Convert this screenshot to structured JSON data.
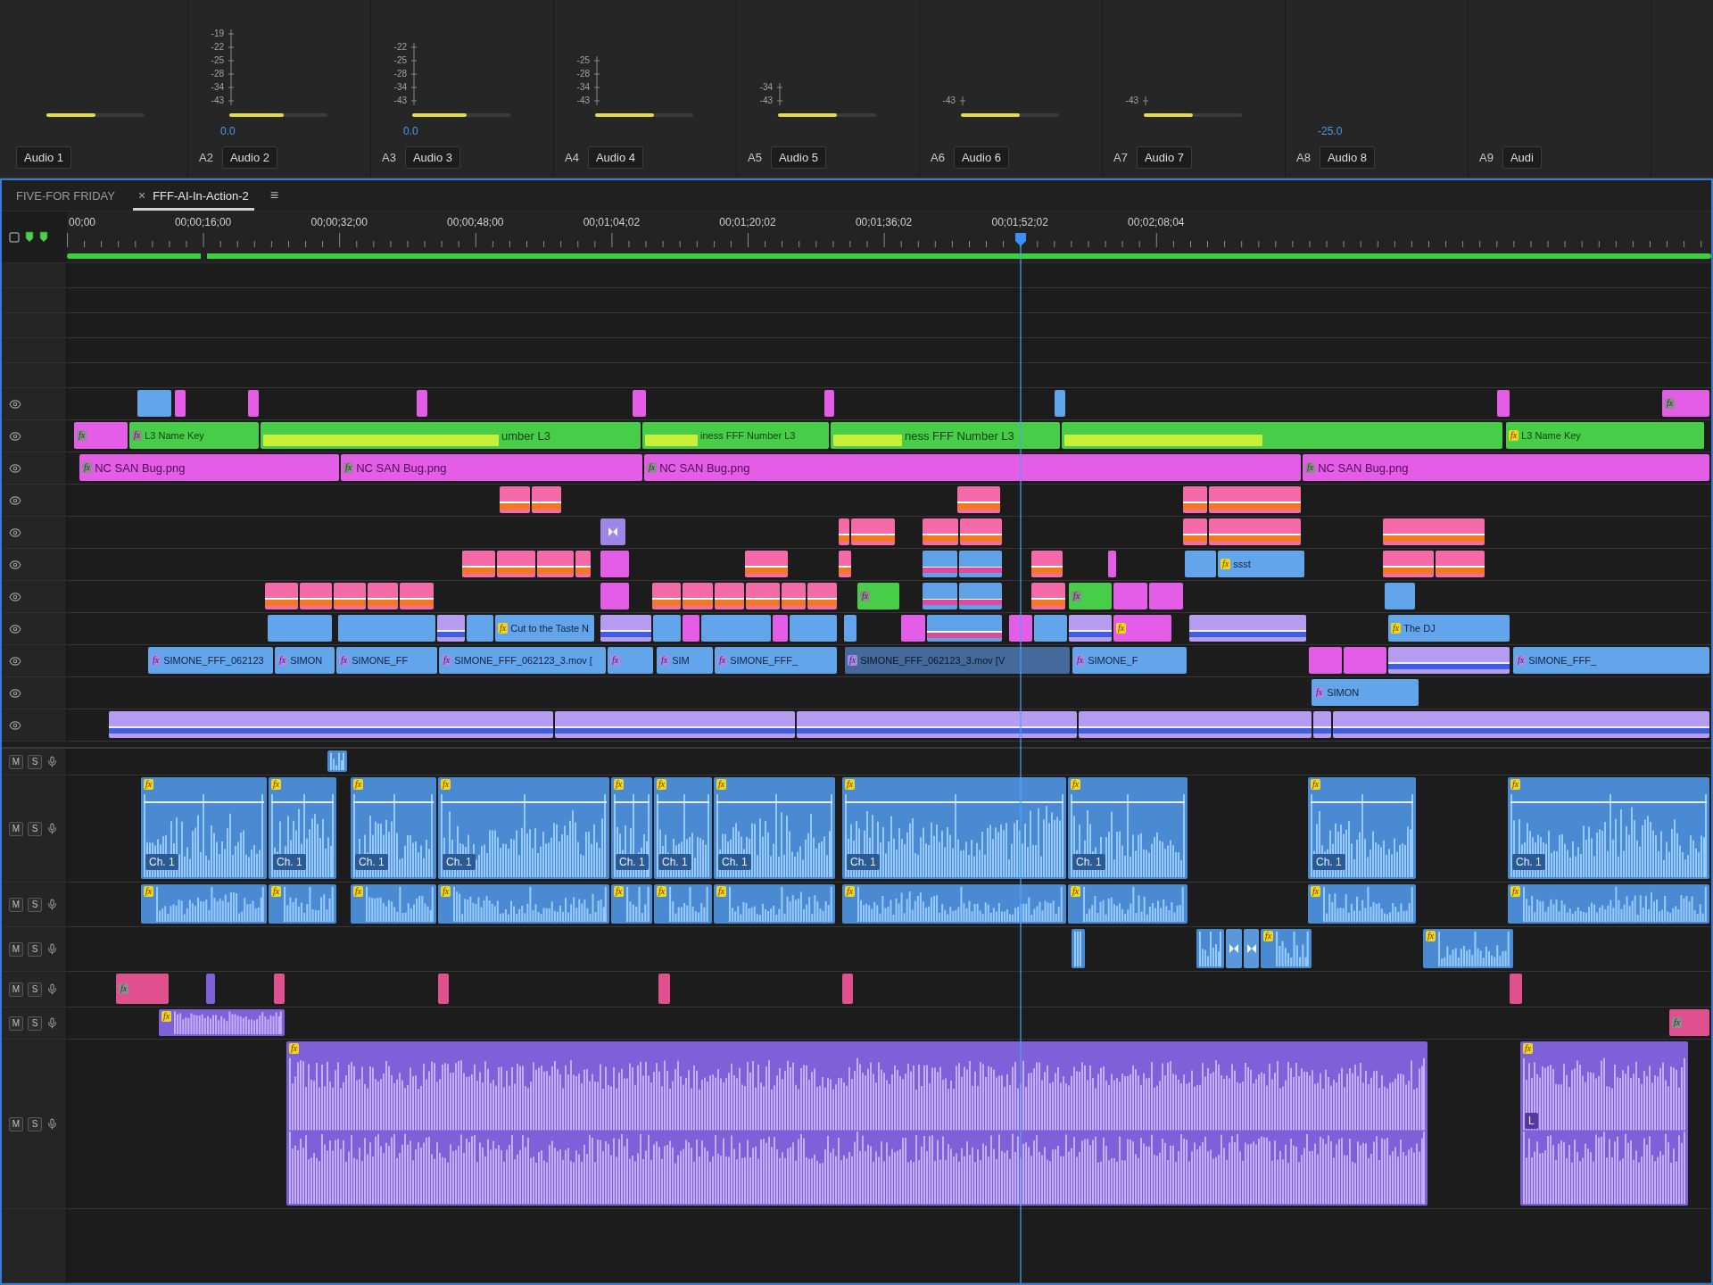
{
  "mixer": {
    "channels": [
      {
        "name": "Audio 1",
        "level": 0.5
      },
      {
        "track": "A2",
        "name": "Audio 2",
        "scale": [
          "-19",
          "-22",
          "-25",
          "-28",
          "-34",
          "-43"
        ],
        "reading": "0.0",
        "level": 0.55
      },
      {
        "track": "A3",
        "name": "Audio 3",
        "scale": [
          "-22",
          "-25",
          "-28",
          "-34",
          "-43"
        ],
        "reading": "0.0",
        "level": 0.55
      },
      {
        "track": "A4",
        "name": "Audio 4",
        "scale": [
          "-25",
          "-28",
          "-34",
          "-43"
        ],
        "level": 0.6
      },
      {
        "track": "A5",
        "name": "Audio 5",
        "scale": [
          "-34",
          "-43"
        ],
        "level": 0.6
      },
      {
        "track": "A6",
        "name": "Audio 6",
        "scale": [
          "-43"
        ],
        "level": 0.6
      },
      {
        "track": "A7",
        "name": "Audio 7",
        "scale": [
          "-43"
        ],
        "level": 0.5
      },
      {
        "track": "A8",
        "name": "Audio 8",
        "reading": "-25.0"
      },
      {
        "track": "A9",
        "name": "Audi"
      }
    ]
  },
  "timeline": {
    "tabs": [
      {
        "label": "FIVE-FOR FRIDAY",
        "selected": false
      },
      {
        "label": "FFF-AI-In-Action-2",
        "selected": true,
        "close": "×",
        "menu": "≡"
      }
    ],
    "ruler": {
      "timecodes": [
        "00;00",
        "00;00;16;00",
        "00;00;32;00",
        "00;00;48;00",
        "00;01;04;02",
        "00;01;20;02",
        "00;01;36;02",
        "00;01;52;02",
        "00;02;08;04"
      ]
    },
    "playhead": {
      "level": 0.58
    },
    "video_tracks": [
      {
        "clips": [
          {
            "kind": "video"
          },
          {
            "kind": "graphic"
          },
          {
            "kind": "graphic"
          },
          {
            "kind": "graphic"
          },
          {
            "kind": "graphic"
          },
          {
            "kind": "graphic"
          },
          {
            "kind": "video"
          },
          {
            "kind": "graphic"
          },
          {
            "kind": "graphic",
            "badge": {
              "text": "fx",
              "kind": "plain"
            }
          }
        ]
      },
      {
        "clips": [
          {
            "kind": "graphic",
            "badge": {
              "text": "fx",
              "kind": "plain"
            }
          },
          {
            "kind": "title",
            "label": "L3 Name Key",
            "badge": {
              "text": "fx",
              "kind": "plain"
            }
          },
          {
            "kind": "title",
            "label": "umber L3",
            "overlay_bar": true
          },
          {
            "kind": "title",
            "label": "iness FFF Number L3",
            "overlay_bar": true
          },
          {
            "kind": "title",
            "label": "ness FFF Number L3",
            "overlay_bar": true
          },
          {
            "kind": "title",
            "overlay_bar": true
          },
          {
            "kind": "title",
            "label": "L3 Name Key",
            "badge": {
              "text": "fx",
              "kind": "applied"
            }
          }
        ]
      },
      {
        "clips": [
          {
            "kind": "graphic",
            "label": "NC SAN Bug.png",
            "badge": {
              "text": "fx",
              "kind": "plain"
            }
          },
          {
            "kind": "graphic",
            "label": "NC SAN Bug.png",
            "badge": {
              "text": "fx",
              "kind": "plain"
            }
          },
          {
            "kind": "graphic",
            "label": "NC SAN Bug.png",
            "badge": {
              "text": "fx",
              "kind": "plain"
            }
          },
          {
            "kind": "graphic",
            "label": "NC SAN Bug.png",
            "badge": {
              "text": "fx",
              "kind": "plain"
            }
          }
        ]
      },
      {
        "clips": [
          {
            "kind": "nest"
          },
          {
            "kind": "nest"
          },
          {
            "kind": "nest"
          },
          {
            "kind": "nest"
          },
          {
            "kind": "nest"
          }
        ]
      },
      {
        "clips": [
          {
            "kind": "transition"
          },
          {
            "kind": "nest"
          },
          {
            "kind": "nest"
          },
          {
            "kind": "nest"
          },
          {
            "kind": "nest"
          },
          {
            "kind": "nest"
          },
          {
            "kind": "nest"
          },
          {
            "kind": "nest"
          }
        ]
      },
      {
        "clips": [
          {
            "kind": "nest"
          },
          {
            "kind": "nest"
          },
          {
            "kind": "nest"
          },
          {
            "kind": "nest"
          },
          {
            "kind": "graphic"
          },
          {
            "kind": "nest"
          },
          {
            "kind": "nest"
          },
          {
            "kind": "composite"
          },
          {
            "kind": "composite"
          },
          {
            "kind": "nest"
          },
          {
            "kind": "graphic"
          },
          {
            "kind": "video"
          },
          {
            "kind": "video",
            "label": "ssst",
            "badge": {
              "text": "fx",
              "kind": "applied"
            }
          },
          {
            "kind": "nest"
          },
          {
            "kind": "nest"
          }
        ]
      },
      {
        "clips": [
          {
            "kind": "nest"
          },
          {
            "kind": "nest"
          },
          {
            "kind": "nest"
          },
          {
            "kind": "nest"
          },
          {
            "kind": "nest"
          },
          {
            "kind": "graphic"
          },
          {
            "kind": "nest"
          },
          {
            "kind": "nest"
          },
          {
            "kind": "nest"
          },
          {
            "kind": "nest"
          },
          {
            "kind": "nest"
          },
          {
            "kind": "nest"
          },
          {
            "kind": "title",
            "badge": {
              "text": "fx",
              "kind": "plain"
            }
          },
          {
            "kind": "composite"
          },
          {
            "kind": "composite"
          },
          {
            "kind": "nest"
          },
          {
            "kind": "title",
            "badge": {
              "text": "fx",
              "kind": "plain"
            }
          },
          {
            "kind": "graphic"
          },
          {
            "kind": "graphic"
          },
          {
            "kind": "video"
          }
        ]
      },
      {
        "clips": [
          {
            "kind": "video"
          },
          {
            "kind": "video"
          },
          {
            "kind": "adjustment"
          },
          {
            "kind": "video"
          },
          {
            "kind": "video",
            "label": "Cut to the Taste N",
            "badge": {
              "text": "fx",
              "kind": "applied"
            }
          },
          {
            "kind": "adjustment"
          },
          {
            "kind": "video"
          },
          {
            "kind": "graphic"
          },
          {
            "kind": "video"
          },
          {
            "kind": "graphic"
          },
          {
            "kind": "video"
          },
          {
            "kind": "video"
          },
          {
            "kind": "graphic"
          },
          {
            "kind": "composite"
          },
          {
            "kind": "graphic"
          },
          {
            "kind": "video"
          },
          {
            "kind": "adjustment"
          },
          {
            "kind": "graphic",
            "badge": {
              "text": "fx",
              "kind": "applied"
            }
          },
          {
            "kind": "adjustment"
          },
          {
            "kind": "video",
            "label": "The DJ",
            "badge": {
              "text": "fx",
              "kind": "applied"
            }
          }
        ]
      },
      {
        "clips": [
          {
            "kind": "video",
            "label": "SIMONE_FFF_062123",
            "badge": {
              "text": "fx",
              "kind": "intrinsic"
            }
          },
          {
            "kind": "video",
            "label": "SIMON",
            "badge": {
              "text": "fx",
              "kind": "intrinsic"
            }
          },
          {
            "kind": "video",
            "label": "SIMONE_FF",
            "badge": {
              "text": "fx",
              "kind": "intrinsic"
            }
          },
          {
            "kind": "video",
            "label": "SIMONE_FFF_062123_3.mov [",
            "badge": {
              "text": "fx",
              "kind": "intrinsic"
            }
          },
          {
            "kind": "video",
            "badge": {
              "text": "fx",
              "kind": "intrinsic"
            }
          },
          {
            "kind": "video",
            "label": "SIM",
            "badge": {
              "text": "fx",
              "kind": "intrinsic"
            }
          },
          {
            "kind": "video",
            "label": "SIMONE_FFF_",
            "badge": {
              "text": "fx",
              "kind": "intrinsic"
            }
          },
          {
            "kind": "merged",
            "label": "SIMONE_FFF_062123_3.mov [V",
            "badge": {
              "text": "fx",
              "kind": "intrinsic"
            }
          },
          {
            "kind": "video",
            "label": "SIMONE_F",
            "badge": {
              "text": "fx",
              "kind": "intrinsic"
            }
          },
          {
            "kind": "graphic"
          },
          {
            "kind": "graphic"
          },
          {
            "kind": "adjustment"
          },
          {
            "kind": "video",
            "label": "SIMONE_FFF_",
            "badge": {
              "text": "fx",
              "kind": "intrinsic"
            }
          }
        ]
      },
      {
        "clips": [
          {
            "kind": "video",
            "label": "SIMON",
            "badge": {
              "text": "fx",
              "kind": "intrinsic"
            }
          }
        ]
      },
      {
        "clips": [
          {
            "kind": "adjustment"
          },
          {
            "kind": "adjustment"
          },
          {
            "kind": "adjustment"
          },
          {
            "kind": "adjustment"
          },
          {
            "kind": "adjustment"
          },
          {
            "kind": "adjustment"
          }
        ]
      }
    ],
    "audio_tracks": [
      {
        "buttons": [
          "M",
          "S"
        ],
        "clips": [
          {
            "kind": "dialogue"
          }
        ]
      },
      {
        "buttons": [
          "M",
          "S"
        ],
        "clips": [
          {
            "kind": "dialogue",
            "badge": {
              "text": "fx",
              "kind": "applied"
            },
            "channel": "Ch. 1"
          },
          {
            "kind": "dialogue",
            "badge": {
              "text": "fx",
              "kind": "applied"
            },
            "channel": "Ch. 1"
          },
          {
            "kind": "dialogue",
            "badge": {
              "text": "fx",
              "kind": "applied"
            },
            "channel": "Ch. 1"
          },
          {
            "kind": "dialogue",
            "badge": {
              "text": "fx",
              "kind": "applied"
            },
            "channel": "Ch. 1"
          },
          {
            "kind": "dialogue",
            "badge": {
              "text": "fx",
              "kind": "applied"
            },
            "channel": "Ch. 1"
          },
          {
            "kind": "dialogue",
            "badge": {
              "text": "fx",
              "kind": "applied"
            },
            "channel": "Ch. 1"
          },
          {
            "kind": "dialogue",
            "badge": {
              "text": "fx",
              "kind": "applied"
            },
            "channel": "Ch. 1"
          },
          {
            "kind": "dialogue",
            "badge": {
              "text": "fx",
              "kind": "applied"
            },
            "channel": "Ch. 1"
          },
          {
            "kind": "dialogue",
            "badge": {
              "text": "fx",
              "kind": "applied"
            },
            "channel": "Ch. 1"
          },
          {
            "kind": "dialogue",
            "badge": {
              "text": "fx",
              "kind": "applied"
            },
            "channel": "Ch. 1"
          },
          {
            "kind": "dialogue",
            "badge": {
              "text": "fx",
              "kind": "applied"
            },
            "channel": "Ch. 1"
          }
        ]
      },
      {
        "buttons": [
          "M",
          "S"
        ],
        "clips": [
          {
            "kind": "dialogue",
            "badge": {
              "text": "fx",
              "kind": "applied"
            }
          },
          {
            "kind": "dialogue",
            "badge": {
              "text": "fx",
              "kind": "applied"
            }
          },
          {
            "kind": "dialogue",
            "badge": {
              "text": "fx",
              "kind": "applied"
            }
          },
          {
            "kind": "dialogue",
            "badge": {
              "text": "fx",
              "kind": "applied"
            }
          },
          {
            "kind": "dialogue",
            "badge": {
              "text": "fx",
              "kind": "applied"
            }
          },
          {
            "kind": "dialogue",
            "badge": {
              "text": "fx",
              "kind": "applied"
            }
          },
          {
            "kind": "dialogue",
            "badge": {
              "text": "fx",
              "kind": "applied"
            }
          },
          {
            "kind": "dialogue",
            "badge": {
              "text": "fx",
              "kind": "applied"
            }
          },
          {
            "kind": "dialogue",
            "badge": {
              "text": "fx",
              "kind": "applied"
            }
          },
          {
            "kind": "dialogue",
            "badge": {
              "text": "fx",
              "kind": "applied"
            }
          },
          {
            "kind": "dialogue",
            "badge": {
              "text": "fx",
              "kind": "applied"
            }
          }
        ]
      },
      {
        "buttons": [
          "M",
          "S"
        ],
        "clips": [
          {
            "kind": "dialogue"
          },
          {
            "kind": "dialogue"
          },
          {
            "kind": "transition"
          },
          {
            "kind": "transition"
          },
          {
            "kind": "dialogue",
            "badge": {
              "text": "fx",
              "kind": "applied"
            }
          },
          {
            "kind": "dialogue",
            "badge": {
              "text": "fx",
              "kind": "applied"
            }
          }
        ]
      },
      {
        "buttons": [
          "M",
          "S"
        ],
        "clips": [
          {
            "kind": "sfx",
            "badge": {
              "text": "fx",
              "kind": "plain"
            }
          },
          {
            "kind": "music"
          },
          {
            "kind": "sfx"
          },
          {
            "kind": "sfx"
          },
          {
            "kind": "sfx"
          },
          {
            "kind": "sfx"
          },
          {
            "kind": "sfx"
          }
        ]
      },
      {
        "buttons": [
          "M",
          "S"
        ],
        "clips": [
          {
            "kind": "music",
            "badge": {
              "text": "fx",
              "kind": "applied"
            }
          },
          {
            "kind": "sfx",
            "badge": {
              "text": "fx",
              "kind": "plain"
            }
          }
        ]
      },
      {
        "buttons": [
          "M",
          "S"
        ],
        "clips": [
          {
            "kind": "music",
            "badge": {
              "text": "fx",
              "kind": "applied"
            }
          },
          {
            "kind": "music",
            "badge": {
              "text": "fx",
              "kind": "applied"
            },
            "channel": "L"
          }
        ]
      }
    ]
  }
}
